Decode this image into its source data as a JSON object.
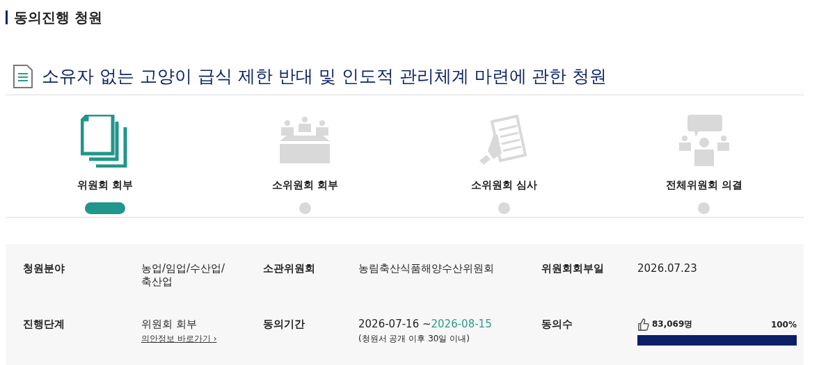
{
  "section_title": "동의진행 청원",
  "petition_title": "소유자 없는 고양이 급식 제한 반대 및 인도적 관리체계 마련에 관한 청원",
  "steps": [
    {
      "kind": "documents",
      "label": "위원회 회부",
      "selected": true
    },
    {
      "kind": "meeting",
      "label": "소위원회 회부",
      "selected": false
    },
    {
      "kind": "review",
      "label": "소위원회 심사",
      "selected": false
    },
    {
      "kind": "discussion",
      "label": "전체위원회 의결",
      "selected": false
    }
  ],
  "info": [
    {
      "kind": "text",
      "label": "청원분야",
      "value": "농업/임업/수산업/축산업"
    },
    {
      "kind": "text",
      "label": "소관위원회",
      "value": "농림축산식품해양수산위원회"
    },
    {
      "kind": "text",
      "label": "위원회회부일",
      "value": "2026.07.23"
    },
    {
      "kind": "stage",
      "label": "진행단계",
      "value": "위원회 회부",
      "link": "의안정보 바로가기 ›"
    },
    {
      "kind": "period",
      "label": "동의기간",
      "start": "2026-07-16 ~",
      "end": "2026-08-15",
      "note": "(청원서 공개 이후 30일 이내)"
    },
    {
      "kind": "count",
      "label": "동의수",
      "count": "83,069명",
      "percent": "100%",
      "level": 1
    }
  ]
}
